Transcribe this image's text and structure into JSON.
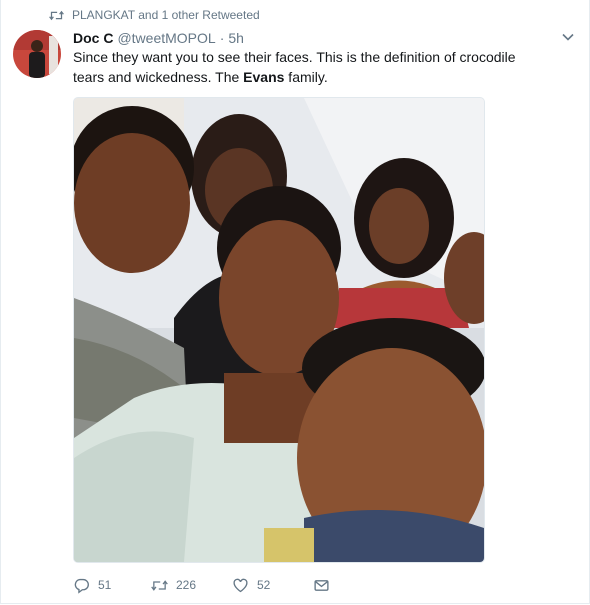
{
  "social_context": {
    "text": "PLANGKAT and 1 other Retweeted",
    "icon": "retweet-icon"
  },
  "author": {
    "name": "Doc C",
    "handle": "@tweetMOPOL",
    "separator": "·",
    "time": "5h"
  },
  "tweet": {
    "text_part1": "Since they want you to see their faces. This is the definition of crocodile tears and wickedness. The ",
    "text_bold": "Evans",
    "text_part2": " family."
  },
  "actions": {
    "reply_count": "51",
    "retweet_count": "226",
    "like_count": "52"
  },
  "colors": {
    "secondary_text": "#657786",
    "border": "#e6ecf0",
    "primary_text": "#14171a"
  }
}
